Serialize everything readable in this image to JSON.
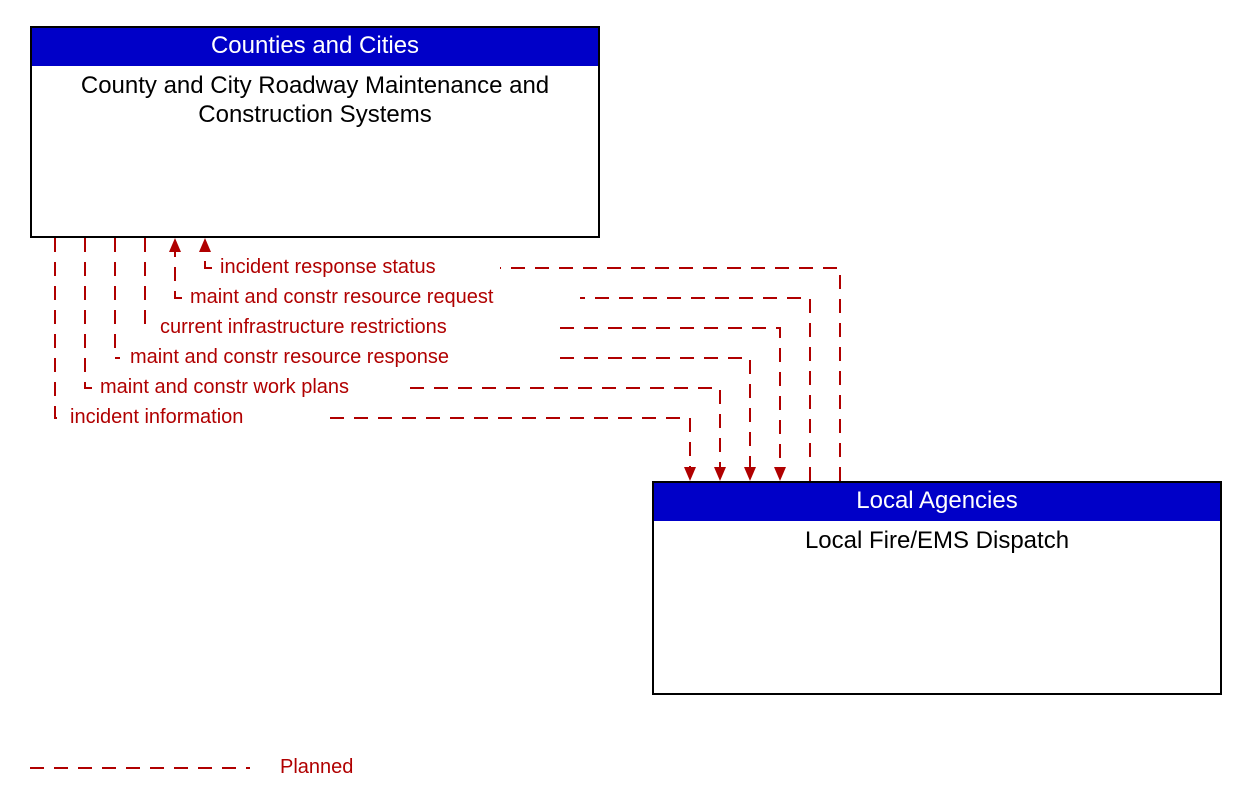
{
  "boxes": {
    "top": {
      "header": "Counties and Cities",
      "body": "County and City Roadway Maintenance and Construction Systems"
    },
    "bottom": {
      "header": "Local Agencies",
      "body": "Local Fire/EMS Dispatch"
    }
  },
  "flows": {
    "f1": "incident response status",
    "f2": "maint and constr resource request",
    "f3": "current infrastructure restrictions",
    "f4": "maint and constr resource response",
    "f5": "maint and constr work plans",
    "f6": "incident information"
  },
  "legend": {
    "planned": "Planned"
  },
  "colors": {
    "header_bg": "#0000c8",
    "flow": "#b00000"
  }
}
